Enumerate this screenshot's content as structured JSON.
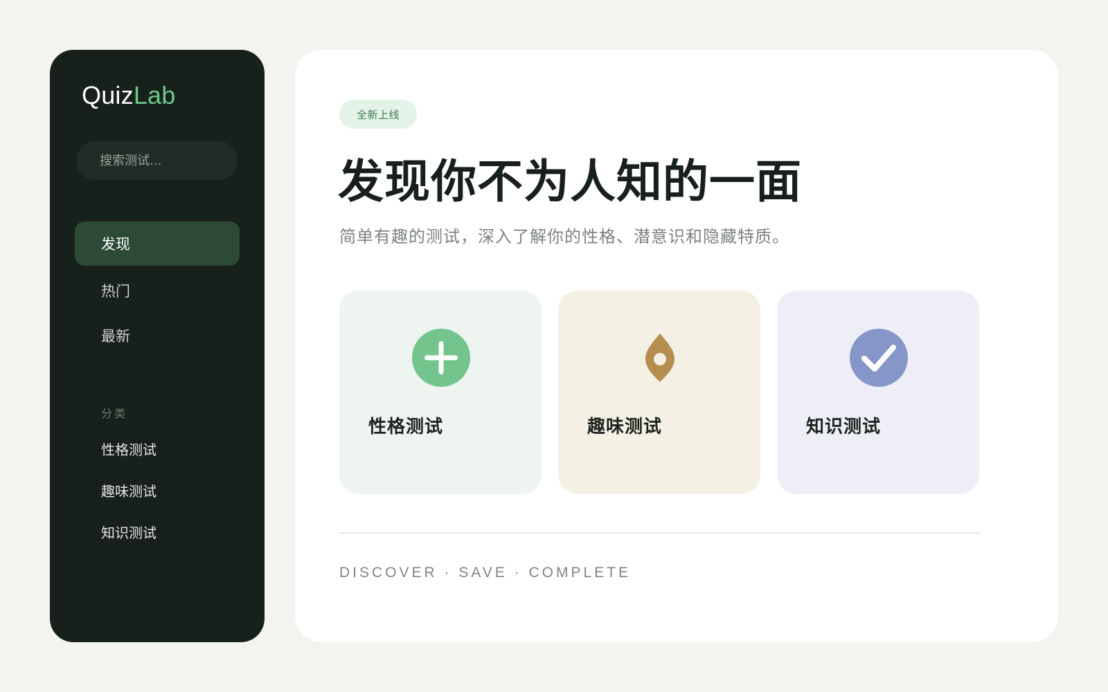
{
  "sidebar": {
    "logo": {
      "part1": "Quiz",
      "part2": "Lab"
    },
    "search": {
      "placeholder": "搜索测试..."
    },
    "nav": [
      {
        "label": "发现",
        "active": true
      },
      {
        "label": "热门",
        "active": false
      },
      {
        "label": "最新",
        "active": false
      }
    ],
    "section_label": "分类",
    "categories": [
      {
        "label": "性格测试"
      },
      {
        "label": "趣味测试"
      },
      {
        "label": "知识测试"
      }
    ]
  },
  "main": {
    "badge": "全新上线",
    "headline": "发现你不为人知的一面",
    "subtitle": "简单有趣的测试，深入了解你的性格、潜意识和隐藏特质。",
    "cards": [
      {
        "label": "性格测试",
        "icon": "plus-circle-icon",
        "color": "#74c48e"
      },
      {
        "label": "趣味测试",
        "icon": "location-pin-icon",
        "color": "#b58d4f"
      },
      {
        "label": "知识测试",
        "icon": "check-circle-icon",
        "color": "#8796c9"
      }
    ],
    "tagline": "DISCOVER · SAVE · COMPLETE"
  }
}
